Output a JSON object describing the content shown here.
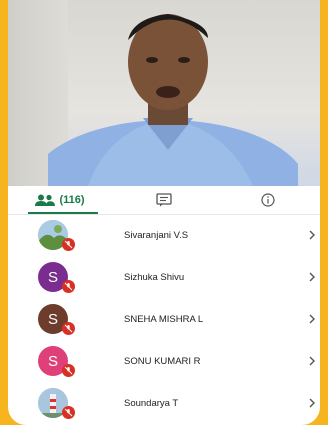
{
  "tabs": {
    "participants_count": "(116)",
    "accent": "#1a7a4a"
  },
  "participants": [
    {
      "initial": "",
      "name": "Sivaranjani V.S",
      "avatar": "photo-landscape",
      "color": "#6b8f4e"
    },
    {
      "initial": "S",
      "name": "Sizhuka Shivu",
      "avatar": "letter",
      "color": "#7b2c8f"
    },
    {
      "initial": "S",
      "name": "SNEHA MISHRA L",
      "avatar": "letter",
      "color": "#6d3c2c"
    },
    {
      "initial": "S",
      "name": "SONU KUMARI R",
      "avatar": "letter",
      "color": "#e0407a"
    },
    {
      "initial": "",
      "name": "Soundarya T",
      "avatar": "photo-lighthouse",
      "color": "#7aa6cf"
    }
  ],
  "mute_color": "#d93025"
}
